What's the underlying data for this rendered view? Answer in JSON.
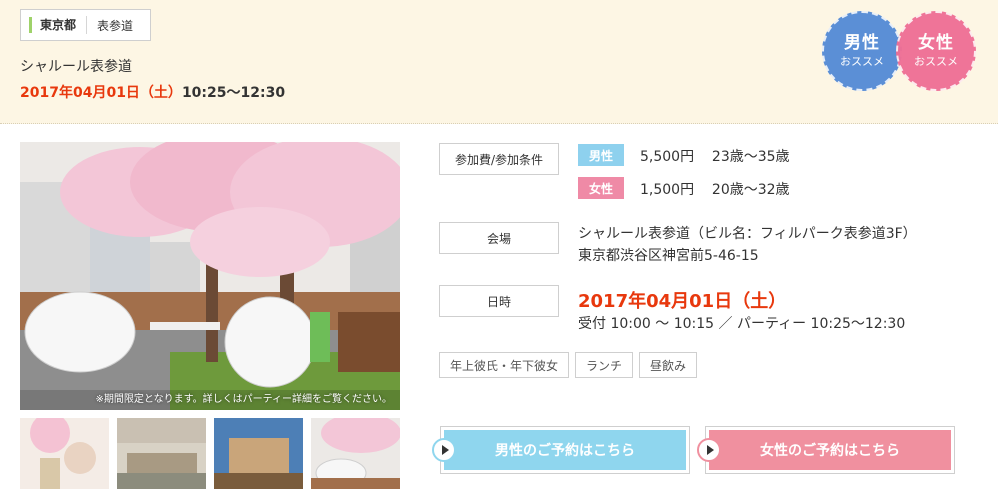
{
  "location": {
    "prefecture": "東京都",
    "area": "表参道"
  },
  "event": {
    "venue_short": "シャルール表参道",
    "date": "2017年04月01日（土）",
    "time": "10:25〜12:30"
  },
  "badges": {
    "male": {
      "line1": "男性",
      "line2": "おススメ",
      "color": "#5b8fd6"
    },
    "female": {
      "line1": "女性",
      "line2": "おススメ",
      "color": "#ef6f95"
    }
  },
  "photo": {
    "caption": "※期間限定となります。詳しくはパーティー詳細をご覧ください。"
  },
  "info": {
    "fee_label": "参加費/参加条件",
    "male_tag": "男性",
    "male_price": "5,500円",
    "male_age": "23歳〜35歳",
    "female_tag": "女性",
    "female_price": "1,500円",
    "female_age": "20歳〜32歳",
    "venue_label": "会場",
    "venue_name": "シャルール表参道（ビル名：フィルパーク表参道3F）",
    "venue_address": "東京都渋谷区神宮前5-46-15",
    "datetime_label": "日時",
    "datetime_big": "2017年04月01日（土）",
    "datetime_detail": "受付 10:00 〜 10:15 ／ パーティー 10:25〜12:30"
  },
  "tags": [
    "年上彼氏・年下彼女",
    "ランチ",
    "昼飲み"
  ],
  "buttons": {
    "male_reserve": "男性のご予約はこちら",
    "female_reserve": "女性のご予約はこちら"
  },
  "colors": {
    "accent_red": "#e8380d",
    "male_blue": "#8fd6ee",
    "female_pink": "#f0909f",
    "header_bg": "#fdf6e4"
  }
}
